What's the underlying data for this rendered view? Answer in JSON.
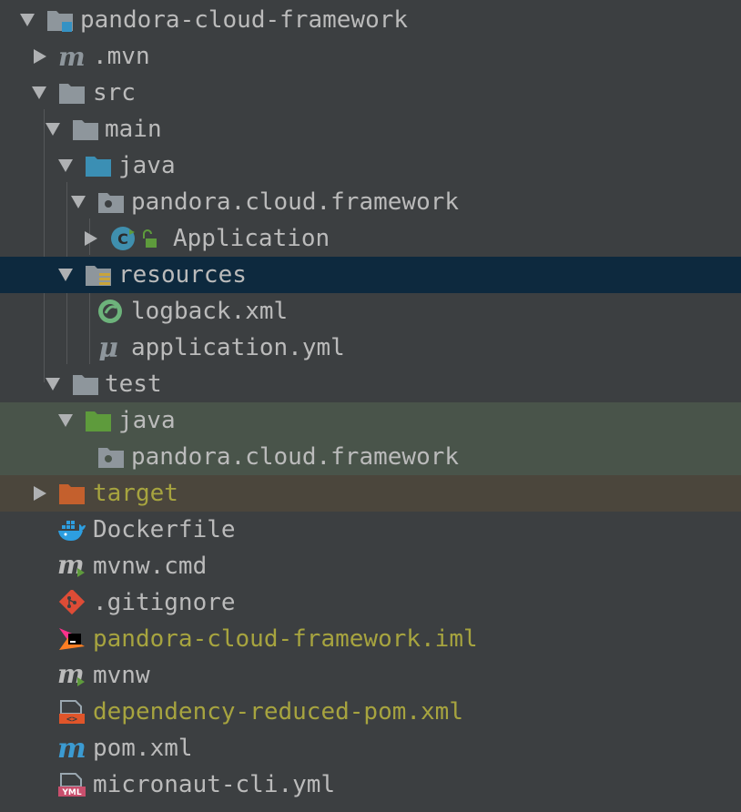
{
  "project_tree": {
    "root": {
      "label": "pandora-cloud-framework"
    },
    "mvn_dir": {
      "label": ".mvn"
    },
    "src": {
      "label": "src"
    },
    "main": {
      "label": "main"
    },
    "main_java": {
      "label": "java"
    },
    "main_package": {
      "label": "pandora.cloud.framework"
    },
    "application_class": {
      "label": "Application"
    },
    "resources": {
      "label": "resources"
    },
    "logback": {
      "label": "logback.xml"
    },
    "application_yml": {
      "label": "application.yml"
    },
    "test": {
      "label": "test"
    },
    "test_java": {
      "label": "java"
    },
    "test_package": {
      "label": "pandora.cloud.framework"
    },
    "target": {
      "label": "target"
    },
    "dockerfile": {
      "label": "Dockerfile"
    },
    "mvnw_cmd": {
      "label": "mvnw.cmd"
    },
    "gitignore": {
      "label": ".gitignore"
    },
    "iml": {
      "label": "pandora-cloud-framework.iml"
    },
    "mvnw": {
      "label": "mvnw"
    },
    "dependency_reduced_pom": {
      "label": "dependency-reduced-pom.xml"
    },
    "pom": {
      "label": "pom.xml"
    },
    "micronaut_cli": {
      "label": "micronaut-cli.yml"
    }
  },
  "icons": {
    "folder": "folder-icon",
    "module": "module-folder-icon",
    "source_root": "source-root-folder-icon",
    "test_root": "test-root-folder-icon",
    "excluded": "excluded-folder-icon",
    "package": "package-icon",
    "class": "class-icon"
  },
  "colors": {
    "background": "#3c3f41",
    "text": "#bbbbbb",
    "excluded_text": "#a7a43f",
    "selection": "#0d293e",
    "test_highlight": "#49544a",
    "excluded_highlight": "#4b463c",
    "folder": "#8e969c",
    "source_root_folder": "#3b8fb4",
    "test_root_folder": "#5e9b3c",
    "excluded_folder": "#c4602d",
    "arrow": "#afb1b3"
  }
}
